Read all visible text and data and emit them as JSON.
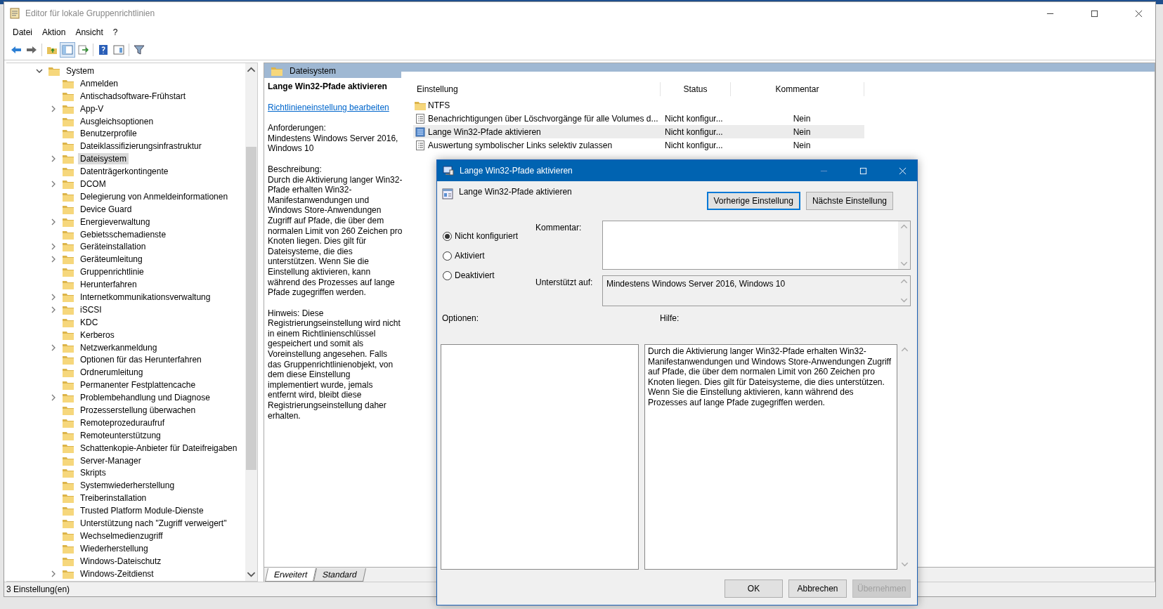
{
  "window": {
    "title": "Editor für lokale Gruppenrichtlinien"
  },
  "menu": [
    "Datei",
    "Aktion",
    "Ansicht",
    "?"
  ],
  "toolbar_buttons": [
    {
      "pressed": false
    },
    {
      "pressed": false
    },
    {
      "pressed": false
    },
    {
      "pressed": true
    },
    {
      "pressed": false
    },
    {
      "pressed": false
    },
    {
      "pressed": false
    },
    {
      "pressed": false
    }
  ],
  "tree": {
    "label": "System",
    "expanded": true,
    "children": [
      {
        "label": "Anmelden",
        "has_children": false,
        "selected": false
      },
      {
        "label": "Antischadsoftware-Frühstart",
        "has_children": false,
        "selected": false
      },
      {
        "label": "App-V",
        "has_children": true,
        "selected": false
      },
      {
        "label": "Ausgleichsoptionen",
        "has_children": false,
        "selected": false
      },
      {
        "label": "Benutzerprofile",
        "has_children": false,
        "selected": false
      },
      {
        "label": "Dateiklassifizierungsinfrastruktur",
        "has_children": false,
        "selected": false
      },
      {
        "label": "Dateisystem",
        "has_children": true,
        "selected": true
      },
      {
        "label": "Datenträgerkontingente",
        "has_children": false,
        "selected": false
      },
      {
        "label": "DCOM",
        "has_children": true,
        "selected": false
      },
      {
        "label": "Delegierung von Anmeldeinformationen",
        "has_children": false,
        "selected": false
      },
      {
        "label": "Device Guard",
        "has_children": false,
        "selected": false
      },
      {
        "label": "Energieverwaltung",
        "has_children": true,
        "selected": false
      },
      {
        "label": "Gebietsschemadienste",
        "has_children": false,
        "selected": false
      },
      {
        "label": "Geräteinstallation",
        "has_children": true,
        "selected": false
      },
      {
        "label": "Geräteumleitung",
        "has_children": true,
        "selected": false
      },
      {
        "label": "Gruppenrichtlinie",
        "has_children": false,
        "selected": false
      },
      {
        "label": "Herunterfahren",
        "has_children": false,
        "selected": false
      },
      {
        "label": "Internetkommunikationsverwaltung",
        "has_children": true,
        "selected": false
      },
      {
        "label": "iSCSI",
        "has_children": true,
        "selected": false
      },
      {
        "label": "KDC",
        "has_children": false,
        "selected": false
      },
      {
        "label": "Kerberos",
        "has_children": false,
        "selected": false
      },
      {
        "label": "Netzwerkanmeldung",
        "has_children": true,
        "selected": false
      },
      {
        "label": "Optionen für das Herunterfahren",
        "has_children": false,
        "selected": false
      },
      {
        "label": "Ordnerumleitung",
        "has_children": false,
        "selected": false
      },
      {
        "label": "Permanenter Festplattencache",
        "has_children": false,
        "selected": false
      },
      {
        "label": "Problembehandlung und Diagnose",
        "has_children": true,
        "selected": false
      },
      {
        "label": "Prozesserstellung überwachen",
        "has_children": false,
        "selected": false
      },
      {
        "label": "Remoteprozeduraufruf",
        "has_children": false,
        "selected": false
      },
      {
        "label": "Remoteunterstützung",
        "has_children": false,
        "selected": false
      },
      {
        "label": "Schattenkopie-Anbieter für Dateifreigaben",
        "has_children": false,
        "selected": false
      },
      {
        "label": "Server-Manager",
        "has_children": false,
        "selected": false
      },
      {
        "label": "Skripts",
        "has_children": false,
        "selected": false
      },
      {
        "label": "Systemwiederherstellung",
        "has_children": false,
        "selected": false
      },
      {
        "label": "Treiberinstallation",
        "has_children": false,
        "selected": false
      },
      {
        "label": "Trusted Platform Module-Dienste",
        "has_children": false,
        "selected": false
      },
      {
        "label": "Unterstützung nach \"Zugriff verweigert\"",
        "has_children": false,
        "selected": false
      },
      {
        "label": "Wechselmedienzugriff",
        "has_children": false,
        "selected": false
      },
      {
        "label": "Wiederherstellung",
        "has_children": false,
        "selected": false
      },
      {
        "label": "Windows-Dateischutz",
        "has_children": false,
        "selected": false
      },
      {
        "label": "Windows-Zeitdienst",
        "has_children": true,
        "selected": false
      }
    ]
  },
  "pane": {
    "header": "Dateisystem",
    "description": {
      "title": "Lange Win32-Pfade aktivieren",
      "link": "Richtlinieneinstellung bearbeiten",
      "requirements_label": "Anforderungen:",
      "requirements": "Mindestens Windows Server 2016, Windows 10",
      "description_label": "Beschreibung:",
      "description": "Durch die Aktivierung langer Win32-Pfade erhalten Win32-Manifestanwendungen und Windows Store-Anwendungen Zugriff auf Pfade, die über dem normalen Limit von 260 Zeichen pro Knoten liegen. Dies gilt für Dateisysteme, die dies unterstützen. Wenn Sie die Einstellung aktivieren, kann während des Prozesses auf lange Pfade zugegriffen werden.",
      "hint": "Hinweis: Diese Registrierungseinstellung wird nicht in einem Richtlinienschlüssel gespeichert und somit als Voreinstellung angesehen. Falls das Gruppenrichtlinienobjekt, von dem diese Einstellung implementiert wurde, jemals entfernt wird, bleibt diese Registrierungseinstellung daher erhalten."
    },
    "columns": [
      "Einstellung",
      "Status",
      "Kommentar"
    ],
    "rows": [
      {
        "kind": "folder",
        "name": "NTFS",
        "selected": false
      },
      {
        "kind": "setting",
        "name": "Benachrichtigungen über Löschvorgänge für alle Volumes d...",
        "status": "Nicht konfigur...",
        "comment": "Nein",
        "selected": false
      },
      {
        "kind": "setting",
        "name": "Lange Win32-Pfade aktivieren",
        "status": "Nicht konfigur...",
        "comment": "Nein",
        "selected": true
      },
      {
        "kind": "setting",
        "name": "Auswertung symbolischer Links selektiv zulassen",
        "status": "Nicht konfigur...",
        "comment": "Nein",
        "selected": false
      }
    ],
    "tabs": [
      {
        "label": "Erweitert",
        "selected": true
      },
      {
        "label": "Standard",
        "selected": false
      }
    ]
  },
  "status_bar": "3 Einstellung(en)",
  "dialog": {
    "title": "Lange Win32-Pfade aktivieren",
    "setting_name": "Lange Win32-Pfade aktivieren",
    "nav_buttons": [
      {
        "label": "Vorherige Einstellung",
        "focused": true
      },
      {
        "label": "Nächste Einstellung",
        "focused": false
      }
    ],
    "radios": [
      {
        "label": "Nicht konfiguriert",
        "selected": true
      },
      {
        "label": "Aktiviert",
        "selected": false
      },
      {
        "label": "Deaktiviert",
        "selected": false
      }
    ],
    "comment_label": "Kommentar:",
    "supported_label": "Unterstützt auf:",
    "supported": "Mindestens Windows Server 2016, Windows 10",
    "options_label": "Optionen:",
    "help_label": "Hilfe:",
    "help": "Durch die Aktivierung langer Win32-Pfade erhalten Win32-Manifestanwendungen und Windows Store-Anwendungen Zugriff auf Pfade, die über dem normalen Limit von 260 Zeichen pro Knoten liegen. Dies gilt für Dateisysteme, die dies unterstützen. Wenn Sie die Einstellung aktivieren, kann während des Prozesses auf lange Pfade zugegriffen werden.",
    "buttons": [
      {
        "label": "OK",
        "disabled": false
      },
      {
        "label": "Abbrechen",
        "disabled": false
      },
      {
        "label": "Übernehmen",
        "disabled": true
      }
    ]
  }
}
